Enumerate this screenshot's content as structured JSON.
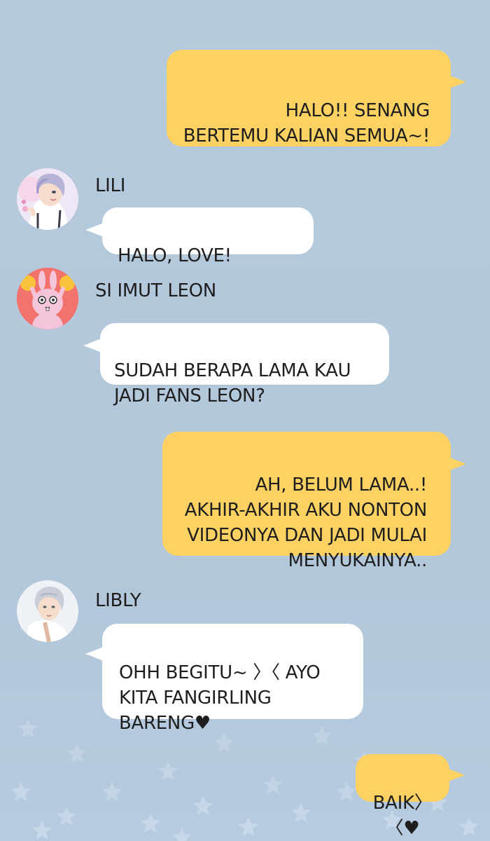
{
  "messages": {
    "m1": "HALO!! SENANG\nBERTEMU KALIAN SEMUA~!",
    "m2": "HALO, LOVE!",
    "m3": "SUDAH BERAPA LAMA KAU\nJADI FANS LEON?",
    "m4": "AH, BELUM LAMA..!\nAKHIR-AKHIR AKU NONTON\nVIDEONYA DAN JADI MULAI\nMENYUKAINYA..",
    "m5": "OHH BEGITU~ 〉〈 AYO\nKITA FANGIRLING\nBARENG♥",
    "m6": "BAIK〉〈♥"
  },
  "users": {
    "lili": {
      "name": "LILI",
      "avatar_icon": "anime-boy-purple-hair-avatar"
    },
    "leon": {
      "name": "SI IMUT LEON",
      "avatar_icon": "pink-bunny-cheerleader-avatar"
    },
    "libly": {
      "name": "LIBLY",
      "avatar_icon": "anime-boy-silver-hair-avatar"
    }
  },
  "colors": {
    "background": "#b6cadd",
    "outgoing_bubble": "#fdd263",
    "incoming_bubble": "#ffffff",
    "leon_avatar_bg": "#f2736d"
  }
}
